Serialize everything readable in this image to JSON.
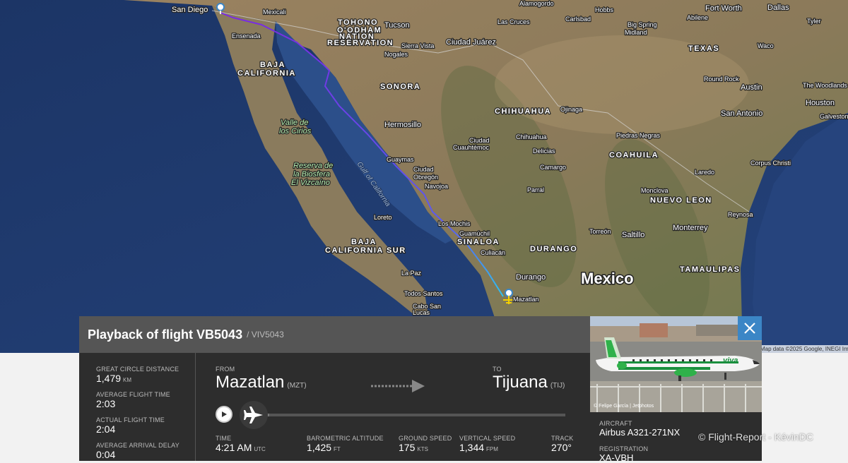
{
  "map": {
    "labels": {
      "san_diego": "San Diego",
      "mexicali": "Mexicali",
      "ensenada": "Ensenada",
      "tohono": "TOHONO",
      "oodham": "O'ODHAM",
      "nation": "NATION",
      "reservation": "RESERVATION",
      "tucson": "Tucson",
      "nogales": "Nogales",
      "sierra_vista": "Sierra Vista",
      "ciudad_juarez": "Ciudad Juárez",
      "las_cruces": "Las Cruces",
      "alamogordo": "Alamogordo",
      "carlsbad": "Carlsbad",
      "hobbs": "Hobbs",
      "big_spring": "Big Spring",
      "midland": "Midland",
      "abilene": "Abilene",
      "fort_worth": "Fort Worth",
      "dallas": "Dallas",
      "tyler": "Tyler",
      "waco": "Waco",
      "texas": "TEXAS",
      "round_rock": "Round Rock",
      "austin": "Austin",
      "the_woodlands": "The Woodlands",
      "houston": "Houston",
      "galveston": "Galveston",
      "san_antonio": "San Antonio",
      "baja": "BAJA",
      "california": "CALIFORNIA",
      "sonora": "SONORA",
      "hermosillo": "Hermosillo",
      "chihuahua_state": "CHIHUAHUA",
      "ojinaga": "Ojinaga",
      "chihuahua_city": "Chihuahua",
      "ciudad_cuauhtemoc_1": "Ciudad",
      "ciudad_cuauhtemoc_2": "Cuauhtémoc",
      "delicias": "Delicias",
      "camargo": "Camargo",
      "piedras_negras": "Piedras Negras",
      "coahuila": "COAHUILA",
      "laredo": "Laredo",
      "corpus_christi": "Corpus Christi",
      "valle_1": "Valle de",
      "valle_2": "los Cirios",
      "reserva_1": "Reserva de",
      "reserva_2": "la Biosfera",
      "reserva_3": "El Vizcaíno",
      "gulf": "Gulf of California",
      "guaymas": "Guaymas",
      "ciudad_obregon_1": "Ciudad",
      "ciudad_obregon_2": "Obregón",
      "navojoa": "Navojoa",
      "parral": "Parral",
      "monclova": "Monclova",
      "nuevo_leon": "NUEVO LEON",
      "reynosa": "Reynosa",
      "loreto": "Loreto",
      "los_mochis": "Los Mochis",
      "guamuchil": "Guamúchil",
      "torreon": "Torreón",
      "saltillo": "Saltillo",
      "monterrey": "Monterrey",
      "baja_sur_1": "BAJA",
      "baja_sur_2": "CALIFORNIA SUR",
      "sinaloa": "SINALOA",
      "culiacan": "Culiacán",
      "durango_state": "DURANGO",
      "la_paz": "La Paz",
      "durango_city": "Durango",
      "mexico": "Mexico",
      "tamaulipas": "TAMAULIPAS",
      "todos_santos": "Todos Santos",
      "mazatlan": "Mazatlan",
      "cabo_1": "Cabo San",
      "cabo_2": "Lucas"
    },
    "attribution": "Map data ©2025 Google, INEGI Im"
  },
  "flight": {
    "title": "Playback of flight VB5043",
    "subtitle": "/ VIV5043",
    "stats": [
      {
        "label": "GREAT CIRCLE DISTANCE",
        "value": "1,479",
        "unit": "KM"
      },
      {
        "label": "AVERAGE FLIGHT TIME",
        "value": "2:03",
        "unit": ""
      },
      {
        "label": "ACTUAL FLIGHT TIME",
        "value": "2:04",
        "unit": ""
      },
      {
        "label": "AVERAGE ARRIVAL DELAY",
        "value": "0:04",
        "unit": ""
      }
    ],
    "from": {
      "label": "FROM",
      "city": "Mazatlan",
      "code": "(MZT)"
    },
    "to": {
      "label": "TO",
      "city": "Tijuana",
      "code": "(TIJ)"
    },
    "playback_progress": 0.02,
    "live": [
      {
        "label": "TIME",
        "value": "4:21 AM",
        "unit": "UTC"
      },
      {
        "label": "BAROMETRIC ALTITUDE",
        "value": "1,425",
        "unit": "FT"
      },
      {
        "label": "GROUND SPEED",
        "value": "175",
        "unit": "KTS"
      },
      {
        "label": "VERTICAL SPEED",
        "value": "1,344",
        "unit": "FPM"
      },
      {
        "label": "TRACK",
        "value": "270°",
        "unit": ""
      }
    ]
  },
  "aircraft": {
    "photo_credit": "© Felipe García | Jetphotos",
    "type_label": "AIRCRAFT",
    "type": "Airbus A321-271NX",
    "registration_label": "REGISTRATION",
    "registration": "XA-VBH",
    "livery_text": "viva"
  },
  "watermark": "© Flight-Report - KévinDC",
  "colors": {
    "accent": "#3b86c6",
    "route_start": "#7a2be0",
    "route_end": "#2ec3f0",
    "panel": "#2d2d2d",
    "header": "#555555"
  }
}
